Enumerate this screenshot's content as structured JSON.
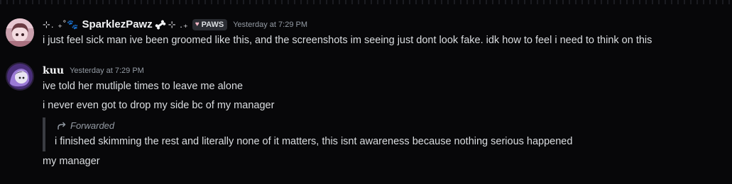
{
  "messages": [
    {
      "username": "SparklezPawz",
      "deco_left": "⊹. ₊˚🐾",
      "deco_right": "⊹ .₊",
      "bone_icon": "bone-icon",
      "tag": {
        "icon": "heart-icon",
        "label": "PAWS"
      },
      "timestamp": "Yesterday at 7:29 PM",
      "lines": [
        "i just feel sick man ive been groomed like this, and the screenshots im seeing just dont look fake. idk how to feel i need to think on this"
      ]
    },
    {
      "username": "kuu",
      "timestamp": "Yesterday at 7:29 PM",
      "lines": [
        "ive told her mutliple times to  leave me alone",
        "i never even got to drop my side bc of my manager"
      ],
      "forwarded": {
        "icon": "forward-arrow-icon",
        "label": "Forwarded",
        "text": "i finished skimming the rest and literally none of it matters, this isnt awareness because nothing serious happened"
      },
      "after_forward": "my manager"
    }
  ],
  "colors": {
    "background": "#070709",
    "username": "#f2f3f5",
    "text": "#dbdee1",
    "muted": "#949ba4",
    "tag_bg": "#2b2d33"
  }
}
